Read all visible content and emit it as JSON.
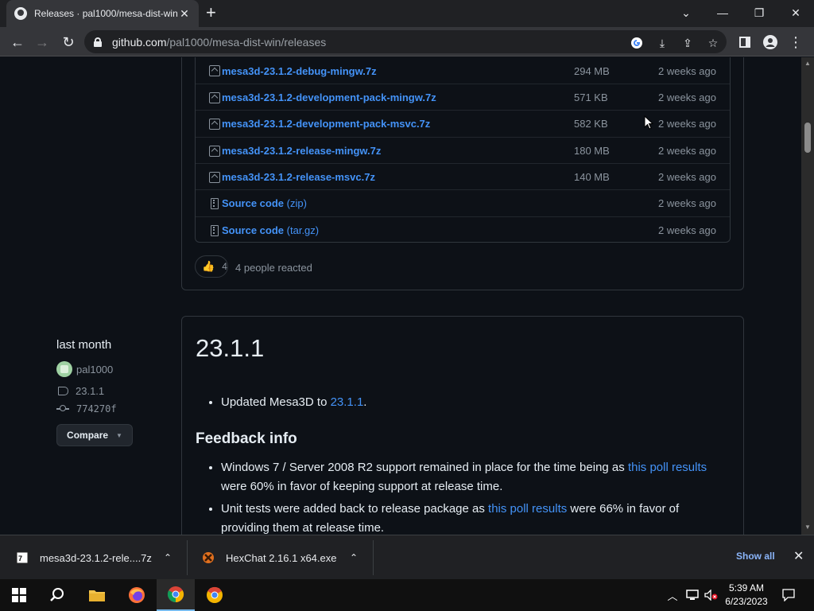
{
  "browser": {
    "tab_title": "Releases · pal1000/mesa-dist-win",
    "url_host": "github.com",
    "url_path": "/pal1000/mesa-dist-win/releases"
  },
  "assets": [
    {
      "name": "mesa3d-23.1.2-debug-mingw.7z",
      "size": "294 MB",
      "date": "2 weeks ago",
      "kind": "package"
    },
    {
      "name": "mesa3d-23.1.2-development-pack-mingw.7z",
      "size": "571 KB",
      "date": "2 weeks ago",
      "kind": "package"
    },
    {
      "name": "mesa3d-23.1.2-development-pack-msvc.7z",
      "size": "582 KB",
      "date": "2 weeks ago",
      "kind": "package"
    },
    {
      "name": "mesa3d-23.1.2-release-mingw.7z",
      "size": "180 MB",
      "date": "2 weeks ago",
      "kind": "package"
    },
    {
      "name": "mesa3d-23.1.2-release-msvc.7z",
      "size": "140 MB",
      "date": "2 weeks ago",
      "kind": "package"
    },
    {
      "name": "Source code",
      "ext": "(zip)",
      "size": "",
      "date": "2 weeks ago",
      "kind": "zip"
    },
    {
      "name": "Source code",
      "ext": "(tar.gz)",
      "size": "",
      "date": "2 weeks ago",
      "kind": "zip"
    }
  ],
  "reactions": {
    "count": "4",
    "text": "4 people reacted"
  },
  "release_meta": {
    "when": "last month",
    "author": "pal1000",
    "tag": "23.1.1",
    "commit": "774270f",
    "compare_label": "Compare"
  },
  "release": {
    "title": "23.1.1",
    "bullet1_prefix": "Updated Mesa3D to ",
    "bullet1_link": "23.1.1",
    "bullet1_suffix": ".",
    "feedback_heading": "Feedback info",
    "fb1_prefix": "Windows 7 / Server 2008 R2 support remained in place for the time being as ",
    "fb1_link": "this poll results",
    "fb1_suffix": " were 60% in favor of keeping support at release time.",
    "fb2_prefix": "Unit tests were added back to release package as ",
    "fb2_link": "this poll results",
    "fb2_suffix": " were 66% in favor of providing them at release time."
  },
  "downloads": [
    {
      "name": "mesa3d-23.1.2-rele....7z"
    },
    {
      "name": "HexChat 2.16.1 x64.exe"
    }
  ],
  "shelf": {
    "show_all": "Show all"
  },
  "clock": {
    "time": "5:39 AM",
    "date": "6/23/2023"
  }
}
